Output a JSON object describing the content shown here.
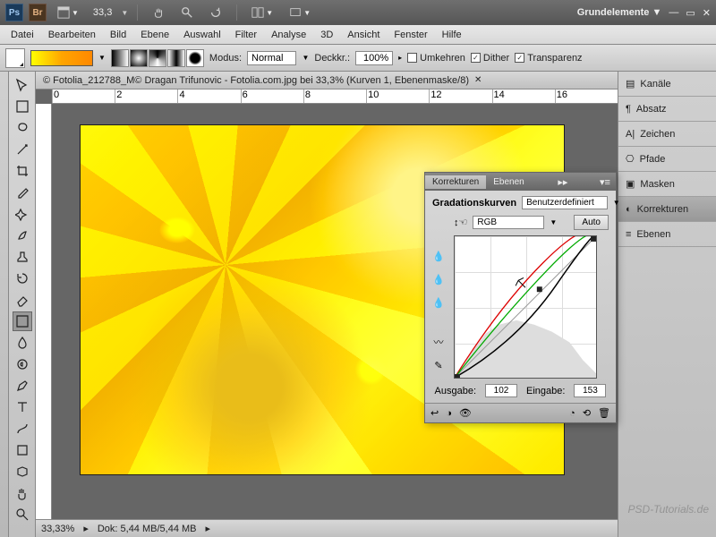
{
  "topbar": {
    "zoom": "33,3",
    "workspace_label": "Grundelemente"
  },
  "menu": [
    "Datei",
    "Bearbeiten",
    "Bild",
    "Ebene",
    "Auswahl",
    "Filter",
    "Analyse",
    "3D",
    "Ansicht",
    "Fenster",
    "Hilfe"
  ],
  "options": {
    "modus_label": "Modus:",
    "modus_value": "Normal",
    "deckkr_label": "Deckkr.:",
    "deckkr_value": "100%",
    "umkehren": "Umkehren",
    "dither": "Dither",
    "transparenz": "Transparenz"
  },
  "doc": {
    "title": "© Fotolia_212788_M© Dragan Trifunovic - Fotolia.com.jpg bei 33,3% (Kurven 1, Ebenenmaske/8)"
  },
  "ruler": [
    "0",
    "2",
    "4",
    "6",
    "8",
    "10",
    "12",
    "14",
    "16"
  ],
  "status": {
    "zoom": "33,33%",
    "dok": "Dok: 5,44 MB/5,44 MB"
  },
  "panels": [
    "Kanäle",
    "Absatz",
    "Zeichen",
    "Pfade",
    "Masken",
    "Korrekturen",
    "Ebenen"
  ],
  "curves": {
    "tab1": "Korrekturen",
    "tab2": "Ebenen",
    "title": "Gradationskurven",
    "preset": "Benutzerdefiniert",
    "channel": "RGB",
    "auto": "Auto",
    "ausgabe_label": "Ausgabe:",
    "ausgabe_value": "102",
    "eingabe_label": "Eingabe:",
    "eingabe_value": "153"
  },
  "watermark": "PSD-Tutorials.de"
}
